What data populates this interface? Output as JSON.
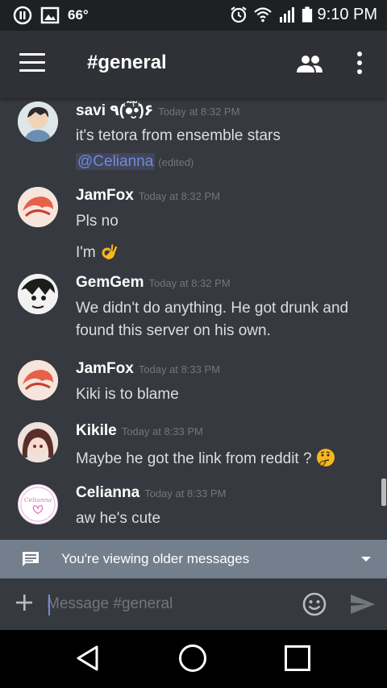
{
  "status_bar": {
    "temperature": "66°",
    "time": "9:10 PM",
    "icons": [
      "pause-icon",
      "image-icon",
      "alarm-icon",
      "wifi-icon",
      "signal-icon",
      "battery-icon"
    ]
  },
  "app_bar": {
    "channel": "#general",
    "icons": [
      "menu-icon",
      "members-icon",
      "more-icon"
    ]
  },
  "messages": [
    {
      "author": "savi ٩(̾●̮̮̃̾•̃̾)۶",
      "timestamp": "Today at 8:32 PM",
      "lines": [
        "it's tetora from ensemble stars"
      ],
      "mention": "@Celianna",
      "edited_label": "(edited)"
    },
    {
      "author": "JamFox",
      "timestamp": "Today at 8:32 PM",
      "lines": [
        "Pls no",
        "I'm"
      ],
      "emoji": "ok-hand-emoji"
    },
    {
      "author": "GemGem",
      "timestamp": "Today at 8:32 PM",
      "lines": [
        "We didn't do anything. He got drunk and",
        "found this server on his own."
      ]
    },
    {
      "author": "JamFox",
      "timestamp": "Today at 8:33 PM",
      "lines": [
        "Kiki is to blame"
      ]
    },
    {
      "author": "Kikile",
      "timestamp": "Today at 8:33 PM",
      "lines": [
        "Maybe he got the link from reddit ?"
      ],
      "emoji": "thinking-face-emoji"
    },
    {
      "author": "Celianna",
      "timestamp": "Today at 8:33 PM",
      "lines": [
        "aw he's cute"
      ],
      "avatar_text": "Celianna"
    }
  ],
  "older_banner": {
    "text": "You're viewing older messages"
  },
  "composer": {
    "placeholder": "Message #general"
  },
  "colors": {
    "background": "#36393f",
    "app_bar": "#2f3136",
    "banner": "#747f8d",
    "mention": "#7289da",
    "timestamp": "#72767d"
  }
}
